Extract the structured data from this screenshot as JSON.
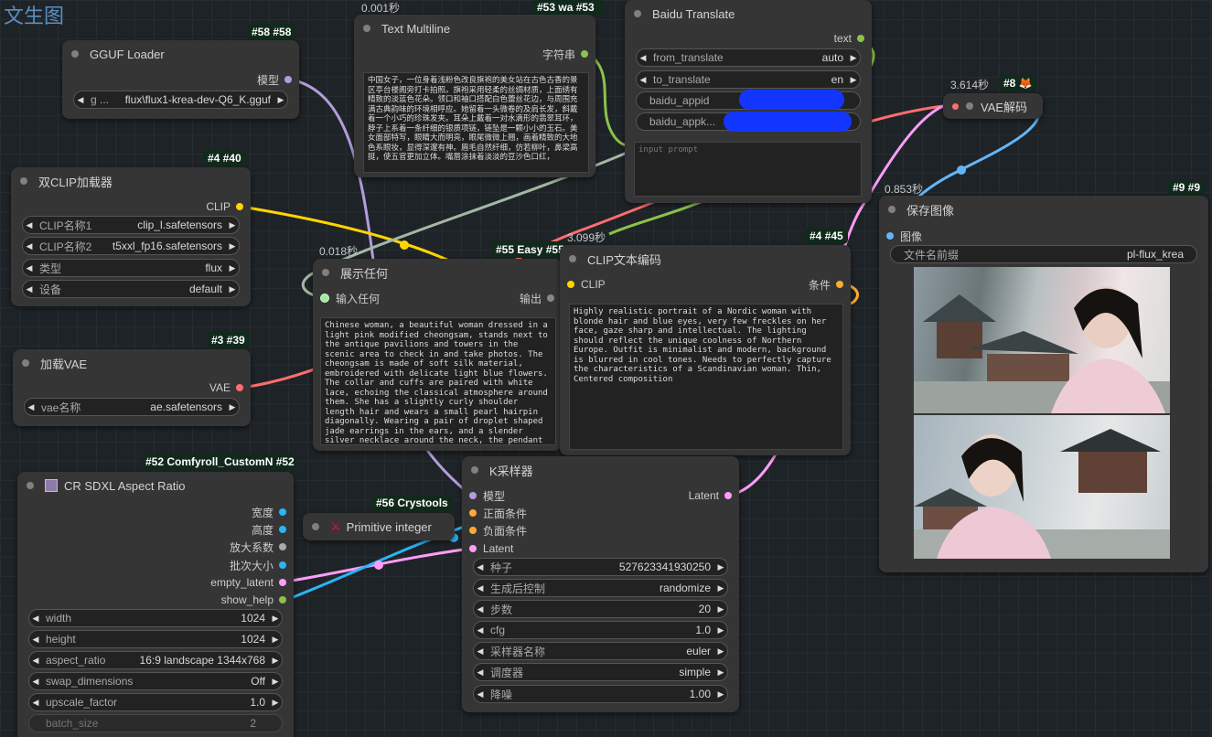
{
  "graph_title": "文生图",
  "colors": {
    "model": "#b39ddb",
    "clip": "#ffd500",
    "vae": "#ff6e6e",
    "latent": "#ff9cf9",
    "string": "#8bc34a",
    "int": "#29b6f6",
    "image": "#64b5f6",
    "cond": "#ffa931"
  },
  "nodes": {
    "gguf": {
      "badge": "#58 #58",
      "title": "GGUF Loader",
      "out_model": "模型",
      "w_prefix": "g ...",
      "w_value": "flux\\flux1-krea-dev-Q6_K.gguf"
    },
    "textmulti": {
      "time": "0.001秒",
      "badge": "#53 wa #53",
      "title": "Text Multiline",
      "out": "字符串",
      "text": "中国女子，一位身着浅粉色改良旗袍的美女站在古色古香的景区亭台楼阁旁打卡拍照。旗袍采用轻柔的丝绸材质，上面绣有精致的淡蓝色花朵。领口和袖口搭配白色蕾丝花边，与周围充满古典韵味的环境相呼应。她留着一头微卷的及肩长发，斜戴着一个小巧的珍珠发夹。耳朵上戴着一对水滴形的翡翠耳环，脖子上系着一条纤细的银质项链，链坠是一颗小小的玉石。美女面部特写，眼睛大而明亮，眼尾微微上翘，画着精致的大地色系眼妆，显得深邃有神。眉毛自然纤细，仿若柳叶，鼻梁高挺，使五官更加立体。嘴唇涂抹着淡淡的豆沙色口红，"
    },
    "baidu": {
      "title": "Baidu Translate",
      "out": "text",
      "from_label": "from_translate",
      "from_value": "auto",
      "to_label": "to_translate",
      "to_value": "en",
      "appid_label": "baidu_appid",
      "appkey_label": "baidu_appk...",
      "placeholder": "input prompt"
    },
    "vaedecode": {
      "time": "3.614秒",
      "badge": "#8 🦊",
      "title": "VAE解码"
    },
    "saveimage": {
      "time": "0.853秒",
      "badge": "#9 #9",
      "title": "保存图像",
      "in_image": "图像",
      "prefix_label": "文件名前缀",
      "prefix_value": "pl-flux_krea"
    },
    "dualclip": {
      "badge": "#4 #40",
      "title": "双CLIP加载器",
      "out": "CLIP",
      "w1_label": "CLIP名称1",
      "w1_value": "clip_l.safetensors",
      "w2_label": "CLIP名称2",
      "w2_value": "t5xxl_fp16.safetensors",
      "w3_label": "类型",
      "w3_value": "flux",
      "w4_label": "设备",
      "w4_value": "default"
    },
    "showany": {
      "time": "0.018秒",
      "badge": "#55 Easy #55",
      "title": "展示任何",
      "in": "输入任何",
      "out": "输出",
      "text": "Chinese woman, a beautiful woman dressed in a light pink modified cheongsam, stands next to the antique pavilions and towers in the scenic area to check in and take photos. The cheongsam is made of soft silk material, embroidered with delicate light blue flowers. The collar and cuffs are paired with white lace, echoing the classical atmosphere around them. She has a slightly curly shoulder length hair and wears a small pearl hairpin diagonally. Wearing a pair of droplet shaped jade earrings in the ears, and a slender silver necklace around the neck, the pendant is a small piece of jade. Close up of the beautiful woman's face, with large and bright eyes,"
    },
    "clipencode": {
      "time": "3.099秒",
      "badge": "#4 #45",
      "title": "CLIP文本编码",
      "in": "CLIP",
      "out": "条件",
      "text": "Highly realistic portrait of a Nordic woman with blonde hair and blue eyes, very few freckles on her face, gaze sharp and intellectual. The lighting should reflect the unique coolness of Northern Europe. Outfit is minimalist and modern, background is blurred in cool tones. Needs to perfectly capture the characteristics of a Scandinavian woman. Thin, Centered composition"
    },
    "loadvae": {
      "badge": "#3 #39",
      "title": "加载VAE",
      "out": "VAE",
      "w_label": "vae名称",
      "w_value": "ae.safetensors"
    },
    "aspect": {
      "badge": "#52 Comfyroll_CustomN #52",
      "title": "CR SDXL Aspect Ratio",
      "outputs": [
        "宽度",
        "高度",
        "放大系数",
        "批次大小",
        "empty_latent",
        "show_help"
      ],
      "widgets": [
        {
          "label": "width",
          "value": "1024"
        },
        {
          "label": "height",
          "value": "1024"
        },
        {
          "label": "aspect_ratio",
          "value": "16:9 landscape 1344x768"
        },
        {
          "label": "swap_dimensions",
          "value": "Off"
        },
        {
          "label": "upscale_factor",
          "value": "1.0"
        },
        {
          "label": "batch_size",
          "value": "2"
        }
      ]
    },
    "primitive": {
      "badge": "#56 Crystools",
      "title": "Primitive integer"
    },
    "ksampler": {
      "title": "K采样器",
      "inputs": [
        "模型",
        "正面条件",
        "负面条件",
        "Latent"
      ],
      "out": "Latent",
      "widgets": [
        {
          "label": "种子",
          "value": "527623341930250"
        },
        {
          "label": "生成后控制",
          "value": "randomize"
        },
        {
          "label": "步数",
          "value": "20"
        },
        {
          "label": "cfg",
          "value": "1.0"
        },
        {
          "label": "采样器名称",
          "value": "euler"
        },
        {
          "label": "调度器",
          "value": "simple"
        },
        {
          "label": "降噪",
          "value": "1.00"
        }
      ]
    }
  }
}
